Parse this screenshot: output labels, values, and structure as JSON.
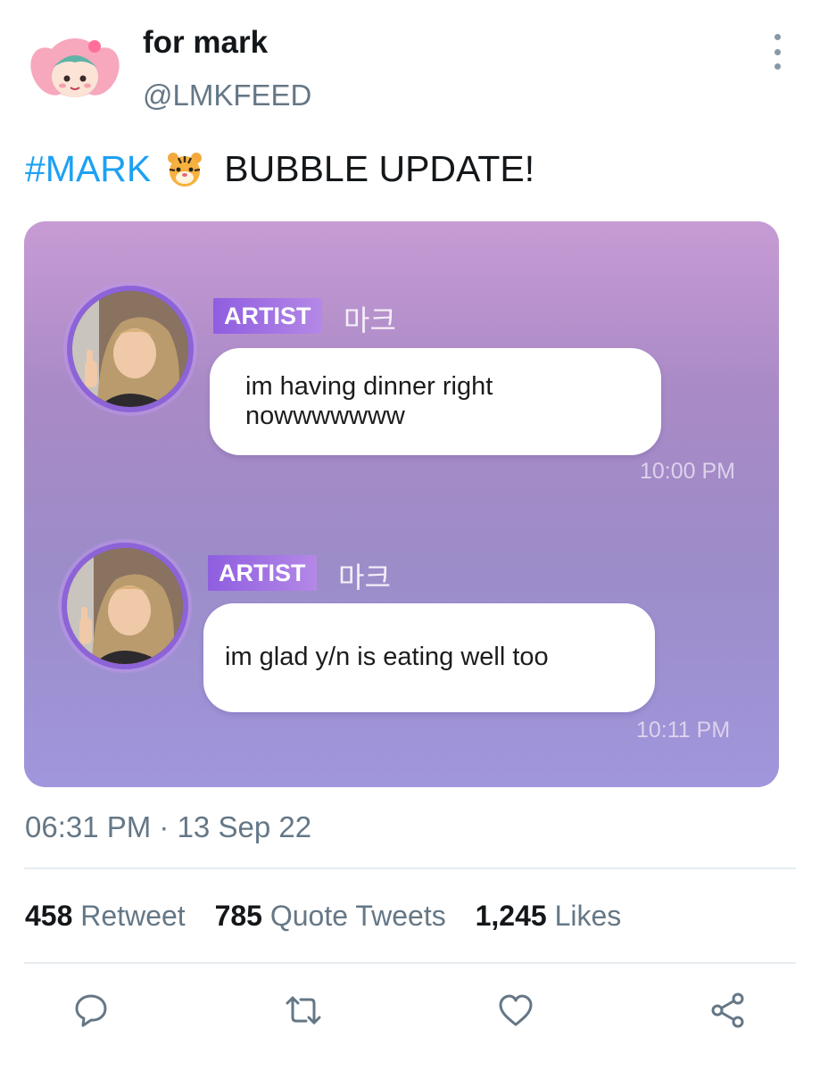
{
  "user": {
    "display_name": "for mark",
    "handle": "@LMKFEED"
  },
  "tweet": {
    "hashtag": "#MARK",
    "emoji": "tiger-face-emoji",
    "text": "BUBBLE UPDATE!",
    "timestamp": "06:31 PM · 13 Sep 22"
  },
  "media": {
    "messages": [
      {
        "badge": "ARTIST",
        "sender": "마크",
        "text_line1": "im having dinner right",
        "text_line2": "nowwwwwww",
        "time": "10:00 PM"
      },
      {
        "badge": "ARTIST",
        "sender": "마크",
        "text_line1": "im glad y/n is eating well too",
        "text_line2": "",
        "time": "10:11 PM"
      }
    ]
  },
  "stats": {
    "retweets_count": "458",
    "retweets_label": "Retweet",
    "quotes_count": "785",
    "quotes_label": "Quote Tweets",
    "likes_count": "1,245",
    "likes_label": "Likes"
  },
  "actions": [
    "reply-icon",
    "retweet-icon",
    "like-icon",
    "share-icon"
  ],
  "colors": {
    "hashtag": "#1da1f2",
    "secondary_text": "#657786",
    "media_gradient_top": "#c79bd4",
    "media_gradient_bottom": "#a096dc",
    "badge": "#8e5ee0"
  }
}
